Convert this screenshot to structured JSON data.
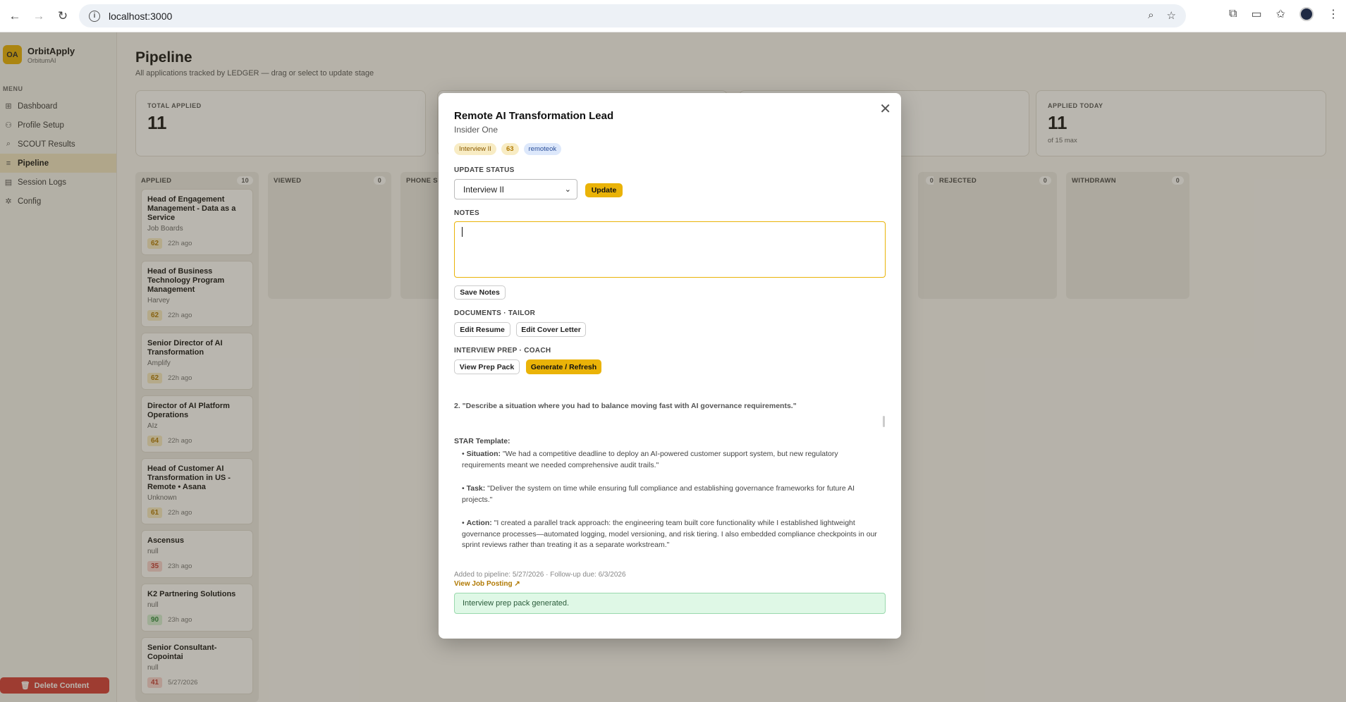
{
  "browser": {
    "url": "localhost:3000"
  },
  "brand": {
    "logo": "OA",
    "name": "OrbitApply",
    "sub": "OrbitumAI"
  },
  "sidebar": {
    "menu_label": "MENU",
    "items": [
      {
        "label": "Dashboard",
        "icon": "grid-icon"
      },
      {
        "label": "Profile Setup",
        "icon": "user-icon"
      },
      {
        "label": "SCOUT Results",
        "icon": "search-icon"
      },
      {
        "label": "Pipeline",
        "icon": "pipeline-icon",
        "active": true
      },
      {
        "label": "Session Logs",
        "icon": "log-icon"
      },
      {
        "label": "Config",
        "icon": "gear-icon"
      }
    ],
    "delete_label": "Delete Content"
  },
  "page": {
    "title": "Pipeline",
    "subtitle": "All applications tracked by LEDGER — drag or select to update stage"
  },
  "stats": {
    "total_label": "TOTAL APPLIED",
    "total_value": "11",
    "today_label": "APPLIED TODAY",
    "today_value": "11",
    "today_sub": "of 15 max"
  },
  "columns": [
    {
      "name": "APPLIED",
      "count": "10"
    },
    {
      "name": "VIEWED",
      "count": "0"
    },
    {
      "name": "PHONE S",
      "count": ""
    },
    {
      "name": "",
      "count": "0"
    },
    {
      "name": "REJECTED",
      "count": "0"
    },
    {
      "name": "WITHDRAWN",
      "count": "0"
    }
  ],
  "cards": [
    {
      "title": "Head of Engagement Management - Data as a Service",
      "company": "Job Boards",
      "score": "62",
      "time": "22h ago"
    },
    {
      "title": "Head of Business Technology Program Management",
      "company": "Harvey",
      "score": "62",
      "time": "22h ago"
    },
    {
      "title": "Senior Director of AI Transformation",
      "company": "Amplify",
      "score": "62",
      "time": "22h ago"
    },
    {
      "title": "Director of AI Platform Operations",
      "company": "AIz",
      "score": "64",
      "time": "22h ago"
    },
    {
      "title": "Head of Customer AI Transformation in US - Remote • Asana",
      "company": "Unknown",
      "score": "61",
      "time": "22h ago"
    },
    {
      "title": "Ascensus",
      "company": "null",
      "score": "35",
      "time": "23h ago"
    },
    {
      "title": "K2 Partnering Solutions",
      "company": "null",
      "score": "90",
      "time": "23h ago"
    },
    {
      "title": "Senior Consultant-Copointai",
      "company": "null",
      "score": "41",
      "time": "5/27/2026"
    }
  ],
  "modal": {
    "title": "Remote AI Transformation Lead",
    "company": "Insider One",
    "tag_stage": "Interview II",
    "tag_score": "63",
    "tag_source": "remoteok",
    "update_status_label": "UPDATE STATUS",
    "status_value": "Interview II",
    "update_button": "Update",
    "notes_label": "NOTES",
    "save_notes": "Save Notes",
    "documents_label": "DOCUMENTS · TAILOR",
    "edit_resume": "Edit Resume",
    "edit_cover": "Edit Cover Letter",
    "prep_label": "INTERVIEW PREP · COACH",
    "view_prep": "View Prep Pack",
    "generate": "Generate / Refresh",
    "question": "2. \"Describe a situation where you had to balance moving fast with AI governance requirements.\"",
    "star_heading": "STAR Template:",
    "situation_label": "Situation:",
    "situation_text": "\"We had a competitive deadline to deploy an AI-powered customer support system, but new regulatory requirements meant we needed comprehensive audit trails.\"",
    "task_label": "Task:",
    "task_text": "\"Deliver the system on time while ensuring full compliance and establishing governance frameworks for future AI projects.\"",
    "action_label": "Action:",
    "action_text": "\"I created a parallel track approach: the engineering team built core functionality while I established lightweight governance processes—automated logging, model versioning, and risk tiering. I also embedded compliance checkpoints in our sprint reviews rather than treating it as a separate workstream.\"",
    "meta": "Added to pipeline: 5/27/2026 · Follow-up due: 6/3/2026",
    "view_posting": "View Job Posting ↗",
    "success": "Interview prep pack generated."
  }
}
